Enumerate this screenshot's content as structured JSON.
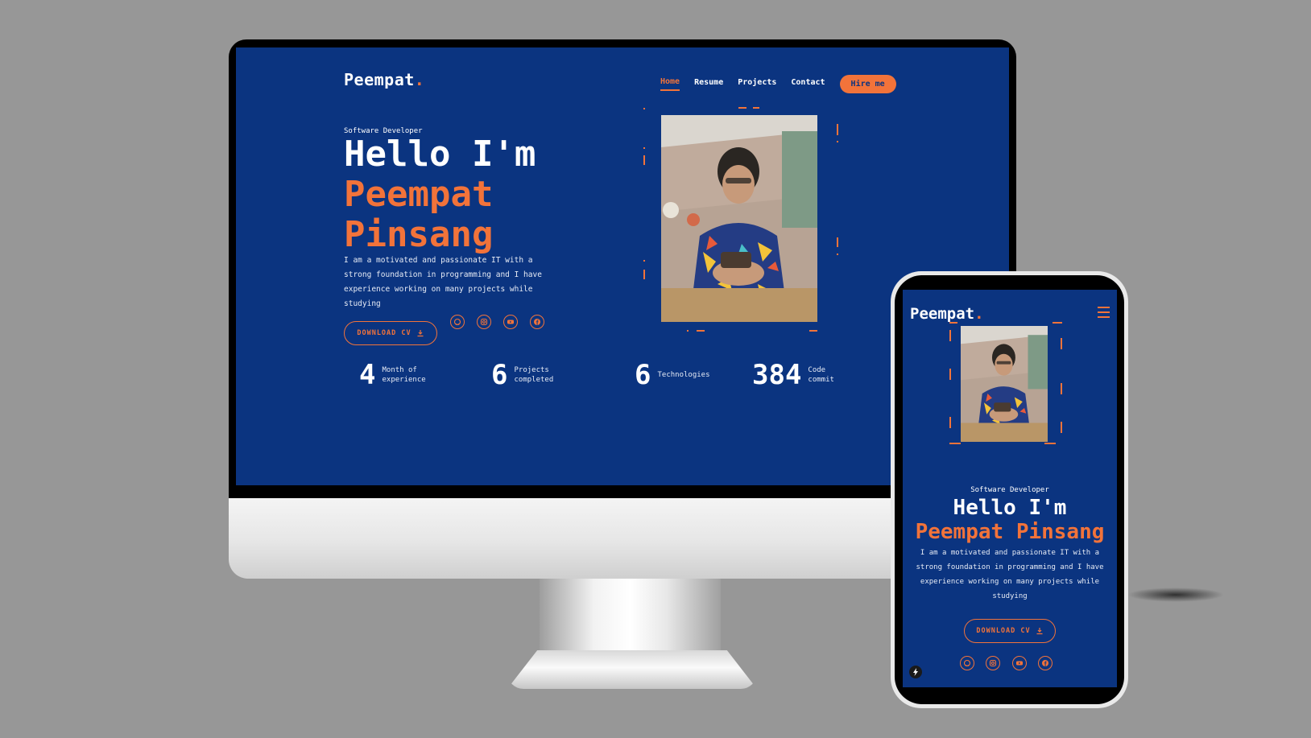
{
  "brand": {
    "name": "Peempat",
    "dot": "."
  },
  "nav": {
    "items": [
      {
        "label": "Home",
        "active": true
      },
      {
        "label": "Resume",
        "active": false
      },
      {
        "label": "Projects",
        "active": false
      },
      {
        "label": "Contact",
        "active": false
      }
    ],
    "cta": "Hire me"
  },
  "hero": {
    "role": "Software Developer",
    "greeting": "Hello I'm",
    "first_name": "Peempat",
    "last_name": "Pinsang",
    "full_name": "Peempat Pinsang",
    "description": "I am a motivated and passionate IT with a strong foundation in programming and I have experience working on many projects while studying",
    "download_label": "DOWNLOAD CV"
  },
  "socials": [
    {
      "icon": "github-icon"
    },
    {
      "icon": "instagram-icon"
    },
    {
      "icon": "youtube-icon"
    },
    {
      "icon": "facebook-icon"
    }
  ],
  "stats": [
    {
      "value": "4",
      "label": "Month of\nexperience"
    },
    {
      "value": "6",
      "label": "Projects\ncompleted"
    },
    {
      "value": "6",
      "label": "Technologies"
    },
    {
      "value": "384",
      "label": "Code\ncommit"
    }
  ],
  "colors": {
    "background": "#0b3480",
    "accent": "#f2733a",
    "text": "#ffffff"
  }
}
